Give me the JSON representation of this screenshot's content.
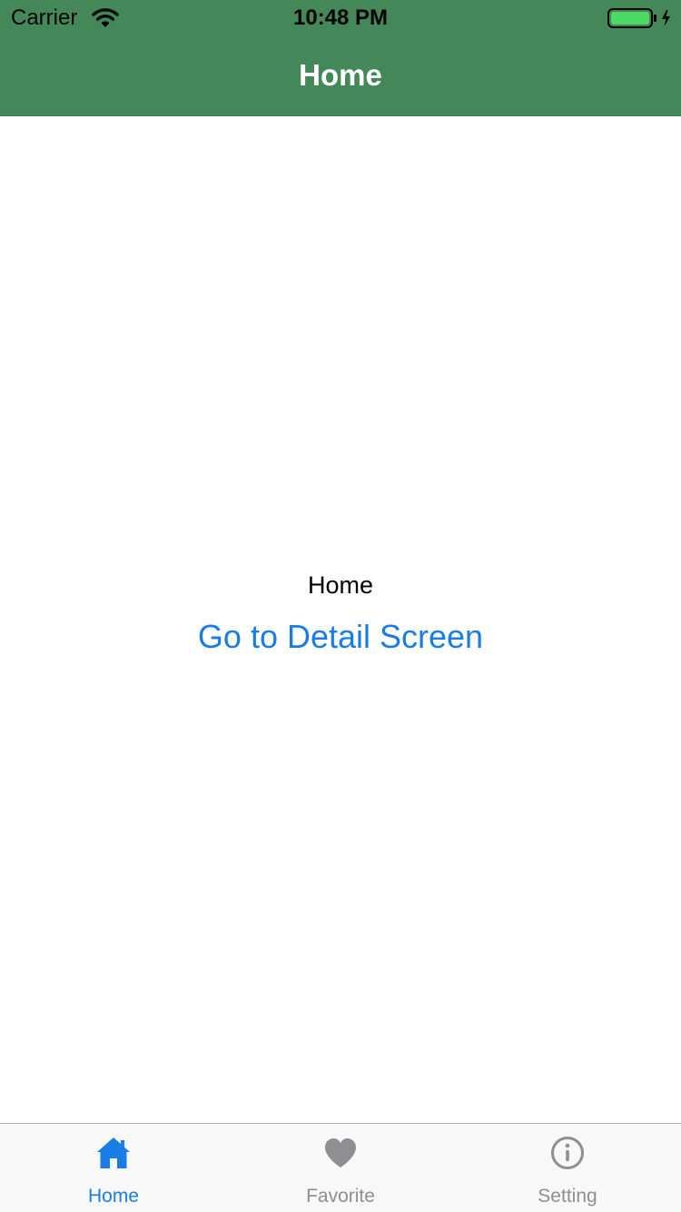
{
  "status_bar": {
    "carrier": "Carrier",
    "time": "10:48 PM",
    "wifi_icon": "wifi-icon",
    "battery_icon": "battery-charging-icon",
    "battery_level": 1.0
  },
  "nav": {
    "title": "Home"
  },
  "content": {
    "text": "Home",
    "link_label": "Go to Detail Screen"
  },
  "tab_bar": {
    "tabs": [
      {
        "label": "Home",
        "icon": "home-icon",
        "active": true
      },
      {
        "label": "Favorite",
        "icon": "heart-icon",
        "active": false
      },
      {
        "label": "Setting",
        "icon": "info-icon",
        "active": false
      }
    ]
  },
  "colors": {
    "header_bg": "#448859",
    "accent": "#1a7de6",
    "inactive": "#8e8e93",
    "battery_fill": "#4cd964"
  }
}
